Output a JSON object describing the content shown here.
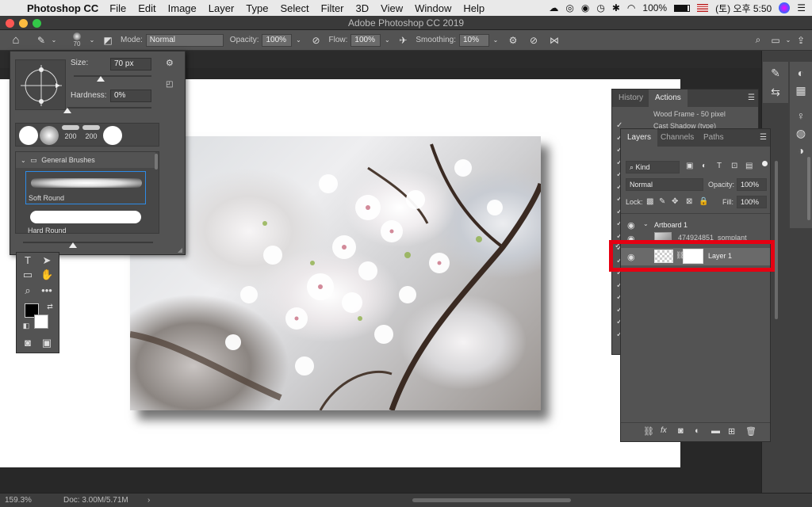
{
  "menubar": {
    "app_name": "Photoshop CC",
    "items": [
      "File",
      "Edit",
      "Image",
      "Layer",
      "Type",
      "Select",
      "Filter",
      "3D",
      "View",
      "Window",
      "Help"
    ],
    "battery": "100%",
    "clock": "(토) 오후 5:50"
  },
  "window": {
    "title": "Adobe Photoshop CC 2019"
  },
  "options_bar": {
    "brush_size": "70",
    "mode_label": "Mode:",
    "mode_value": "Normal",
    "opacity_label": "Opacity:",
    "opacity_value": "100%",
    "flow_label": "Flow:",
    "flow_value": "100%",
    "smoothing_label": "Smoothing:",
    "smoothing_value": "10%"
  },
  "brush_picker": {
    "size_label": "Size:",
    "size_value": "70 px",
    "hardness_label": "Hardness:",
    "hardness_value": "0%",
    "size_fraction": 0.35,
    "hardness_fraction": 0.0,
    "presets": [
      "200",
      "200"
    ],
    "group_name": "General Brushes",
    "brushes": [
      "Soft Round",
      "Hard Round"
    ]
  },
  "history_panel": {
    "tabs": [
      "History",
      "Actions"
    ],
    "active_tab": "Actions",
    "items": [
      "Wood Frame - 50 pixel",
      "Cast Shadow (type)"
    ]
  },
  "layers_panel": {
    "tabs": [
      "Layers",
      "Channels",
      "Paths"
    ],
    "kind_filter": "Kind",
    "blend_mode": "Normal",
    "opacity_label": "Opacity:",
    "opacity_value": "100%",
    "lock_label": "Lock:",
    "fill_label": "Fill:",
    "fill_value": "100%",
    "artboard_name": "Artboard 1",
    "layers": [
      {
        "name": "474924851_somplant"
      },
      {
        "name": "Layer 1"
      }
    ]
  },
  "status_bar": {
    "zoom": "159.3%",
    "doc_info": "Doc: 3.00M/5.71M"
  },
  "colors": {
    "highlight": "#e60012",
    "panel_bg": "#535353",
    "menubar_bg": "#e9e9e9"
  }
}
